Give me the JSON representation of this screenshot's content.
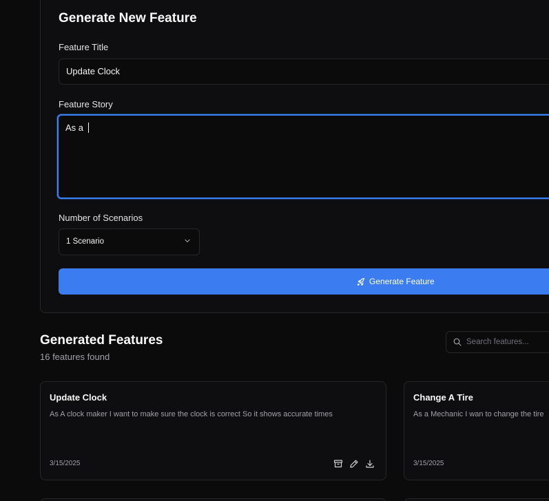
{
  "form": {
    "heading": "Generate New Feature",
    "title_label": "Feature Title",
    "title_value": "Update Clock",
    "story_label": "Feature Story",
    "story_value": "As a ",
    "scenarios_label": "Number of Scenarios",
    "scenarios_selected": "1 Scenario",
    "generate_label": "Generate Feature"
  },
  "list": {
    "heading": "Generated Features",
    "count_text": "16 features found",
    "search_placeholder": "Search features..."
  },
  "cards": [
    {
      "title": "Update Clock",
      "description": "As A clock maker I want to make sure the clock is correct So it shows accurate times",
      "date": "3/15/2025"
    },
    {
      "title": "Change A Tire",
      "description": "As a Mechanic I wan to change the tire",
      "date": "3/15/2025"
    }
  ],
  "colors": {
    "accent": "#3b7cf0",
    "focus_ring": "#3b82f6",
    "background": "#0b0b0c",
    "border": "#27272a"
  },
  "icons": {
    "generate_button": "rocket-icon",
    "select": "chevron-down-icon",
    "search": "search-icon",
    "card_actions": [
      "archive-icon",
      "pencil-icon",
      "download-icon"
    ]
  }
}
